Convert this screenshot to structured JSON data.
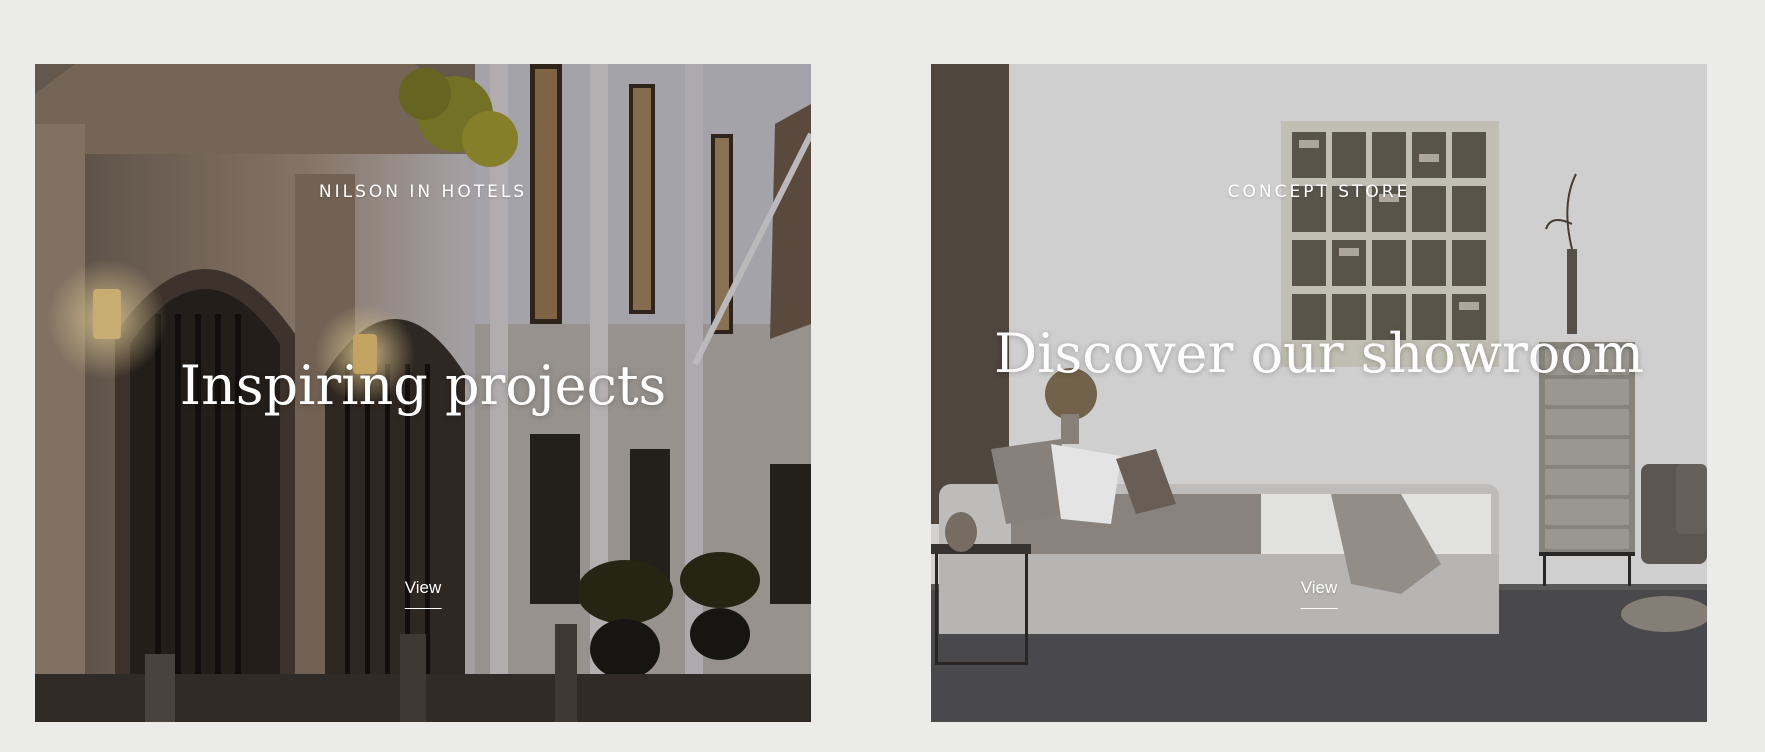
{
  "cards": [
    {
      "eyebrow": "NILSON IN HOTELS",
      "headline": "Inspiring projects",
      "link_label": "View",
      "image_icon": "hotel-facade-photo"
    },
    {
      "eyebrow": "CONCEPT STORE",
      "headline": "Discover our showroom",
      "link_label": "View",
      "image_icon": "bedroom-showroom-photo"
    }
  ],
  "colors": {
    "page_background": "#ebebea",
    "text": "#ffffff"
  }
}
